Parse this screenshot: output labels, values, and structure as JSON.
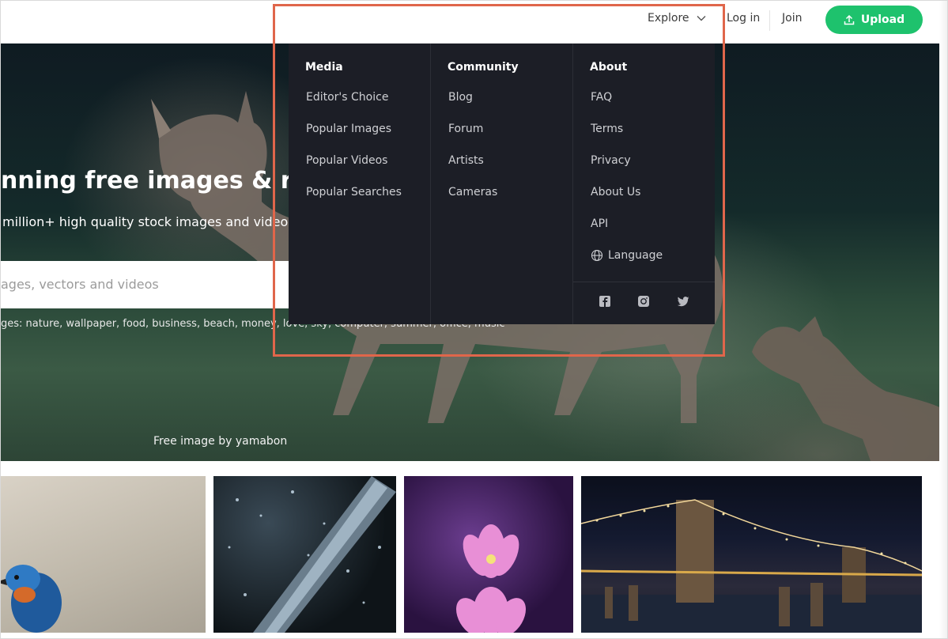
{
  "header": {
    "explore_label": "Explore",
    "login_label": "Log in",
    "join_label": "Join",
    "upload_label": "Upload",
    "accent_color": "#1ec26d"
  },
  "hero": {
    "title": "nning free images & roy",
    "subtitle": "million+ high quality stock images and videos sha",
    "search_placeholder": "ages, vectors and videos",
    "tags_text": "ges: nature, wallpaper, food, business, beach, money, love, sky, computer, summer, office, music",
    "credit": "Free image by yamabon"
  },
  "dropdown": {
    "columns": [
      {
        "heading": "Media",
        "items": [
          "Editor's Choice",
          "Popular Images",
          "Popular Videos",
          "Popular Searches"
        ]
      },
      {
        "heading": "Community",
        "items": [
          "Blog",
          "Forum",
          "Artists",
          "Cameras"
        ]
      },
      {
        "heading": "About",
        "items": [
          "FAQ",
          "Terms",
          "Privacy",
          "About Us",
          "API",
          "Language"
        ]
      }
    ],
    "social_icons": [
      "facebook-icon",
      "instagram-icon",
      "twitter-icon"
    ],
    "highlight_color": "#e0664b"
  },
  "gallery": {
    "thumbnails": [
      "kingfisher bird",
      "rain on metal rail",
      "pink lotus flowers",
      "bridge at night"
    ]
  }
}
